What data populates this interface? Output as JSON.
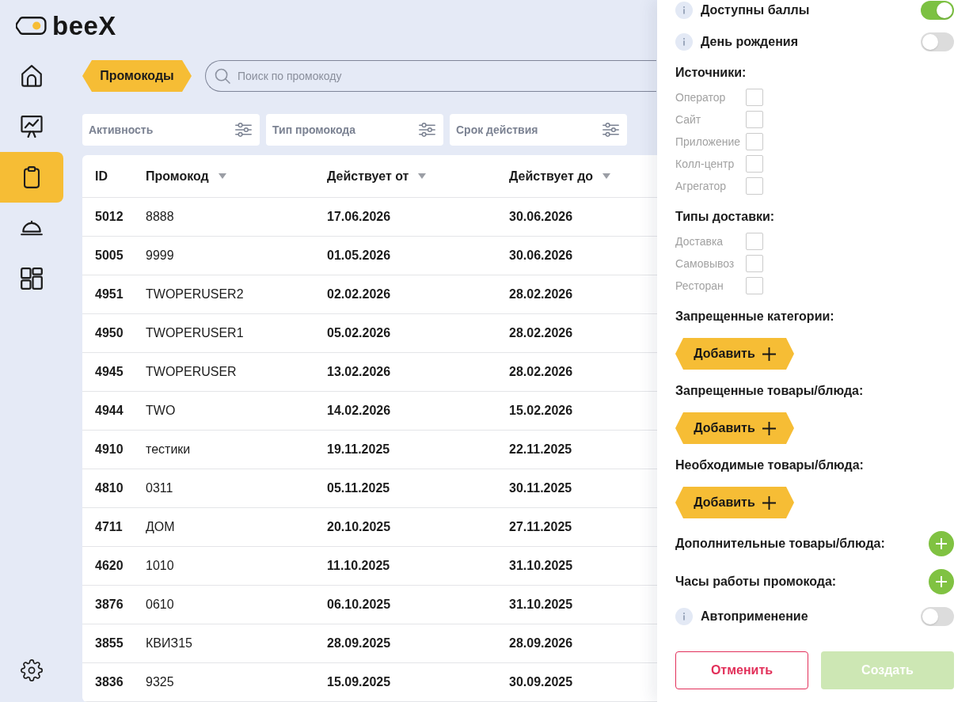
{
  "logo": {
    "text": "beeX"
  },
  "sidebar": {
    "items": [
      {
        "selected": false
      },
      {
        "selected": false
      },
      {
        "selected": true
      },
      {
        "selected": false
      },
      {
        "selected": false
      }
    ]
  },
  "toolbar": {
    "tab": "Промокоды",
    "search": {
      "placeholder": "Поиск по промокоду"
    }
  },
  "filters": [
    {
      "label": "Активность"
    },
    {
      "label": "Тип промокода"
    },
    {
      "label": "Срок действия"
    }
  ],
  "table": {
    "columns": [
      {
        "label": "ID",
        "sortable": false
      },
      {
        "label": "Промокод",
        "sortable": true
      },
      {
        "label": "Действует от",
        "sortable": true
      },
      {
        "label": "Действует до",
        "sortable": true
      }
    ],
    "rows": [
      [
        "5012",
        "8888",
        "17.06.2026",
        "30.06.2026"
      ],
      [
        "5005",
        "9999",
        "01.05.2026",
        "30.06.2026"
      ],
      [
        "4951",
        "TWOPERUSER2",
        "02.02.2026",
        "28.02.2026"
      ],
      [
        "4950",
        "TWOPERUSER1",
        "05.02.2026",
        "28.02.2026"
      ],
      [
        "4945",
        "TWOPERUSER",
        "13.02.2026",
        "28.02.2026"
      ],
      [
        "4944",
        "TWO",
        "14.02.2026",
        "15.02.2026"
      ],
      [
        "4910",
        "тестики",
        "19.11.2025",
        "22.11.2025"
      ],
      [
        "4810",
        "0311",
        "05.11.2025",
        "30.11.2025"
      ],
      [
        "4711",
        "ДОМ",
        "20.10.2025",
        "27.11.2025"
      ],
      [
        "4620",
        "1010",
        "11.10.2025",
        "31.10.2025"
      ],
      [
        "3876",
        "0610",
        "06.10.2025",
        "31.10.2025"
      ],
      [
        "3855",
        "КВИЗ15",
        "28.09.2025",
        "28.09.2026"
      ],
      [
        "3836",
        "9325",
        "15.09.2025",
        "30.09.2025"
      ]
    ]
  },
  "panel": {
    "flags": [
      {
        "label": "Доступны баллы",
        "on": true
      },
      {
        "label": "День рождения",
        "on": false
      }
    ],
    "checkbox_groups": [
      {
        "title": "Источники:",
        "options": [
          {
            "label": "Оператор",
            "checked": false
          },
          {
            "label": "Сайт",
            "checked": false
          },
          {
            "label": "Приложение",
            "checked": false
          },
          {
            "label": "Колл-центр",
            "checked": false
          },
          {
            "label": "Агрегатор",
            "checked": false
          }
        ]
      },
      {
        "title": "Типы доставки:",
        "options": [
          {
            "label": "Доставка",
            "checked": false
          },
          {
            "label": "Самовывоз",
            "checked": false
          },
          {
            "label": "Ресторан",
            "checked": false
          }
        ]
      }
    ],
    "pickers": [
      {
        "title": "Запрещенные категории:",
        "button": "Добавить"
      },
      {
        "title": "Запрещенные товары/блюда:",
        "button": "Добавить"
      },
      {
        "title": "Необходимые товары/блюда:",
        "button": "Добавить"
      }
    ],
    "extras": [
      {
        "title": "Дополнительные товары/блюда:"
      },
      {
        "title": "Часы работы промокода:"
      }
    ],
    "auto_apply": {
      "label": "Автоприменение",
      "on": false
    },
    "actions": [
      {
        "label": "Отменить",
        "kind": "cancel",
        "disabled": false
      },
      {
        "label": "Создать",
        "kind": "submit",
        "disabled": true
      }
    ]
  }
}
